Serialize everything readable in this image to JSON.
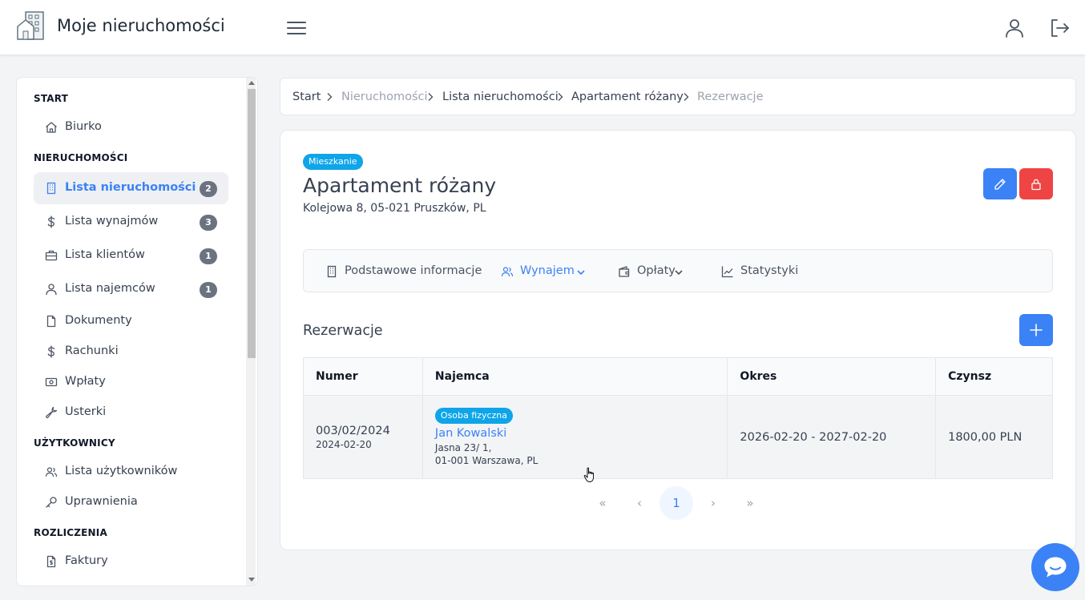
{
  "header": {
    "app_title": "Moje nieruchomości",
    "icons": [
      "building-logo-icon",
      "menu-icon",
      "user-icon",
      "logout-icon"
    ]
  },
  "sidebar": {
    "sections": [
      {
        "label": "START"
      },
      {
        "label": "NIERUCHOMOŚCI"
      },
      {
        "label": "UŻYTKOWNICY"
      },
      {
        "label": "ROZLICZENIA"
      }
    ],
    "items": [
      {
        "label": "Biurko",
        "icon": "home-icon"
      },
      {
        "label": "Lista nieruchomości",
        "icon": "building-icon",
        "badge": "2",
        "active": true
      },
      {
        "label": "Lista wynajmów",
        "icon": "dollar-icon",
        "badge": "3"
      },
      {
        "label": "Lista klientów",
        "icon": "briefcase-icon",
        "badge": "1"
      },
      {
        "label": "Lista najemców",
        "icon": "user-icon",
        "badge": "1"
      },
      {
        "label": "Dokumenty",
        "icon": "document-icon"
      },
      {
        "label": "Rachunki",
        "icon": "dollar-icon"
      },
      {
        "label": "Wpłaty",
        "icon": "cash-icon"
      },
      {
        "label": "Usterki",
        "icon": "wrench-icon"
      },
      {
        "label": "Lista użytkowników",
        "icon": "users-icon"
      },
      {
        "label": "Uprawnienia",
        "icon": "key-icon"
      },
      {
        "label": "Faktury",
        "icon": "invoice-icon"
      }
    ]
  },
  "breadcrumb": {
    "items": [
      "Start",
      "Nieruchomości",
      "Lista nieruchomości",
      "Apartament różany",
      "Rezerwacje"
    ]
  },
  "property": {
    "type_badge": "Mieszkanie",
    "title": "Apartament różany",
    "address": "Kolejowa 8, 05-021 Pruszków, PL"
  },
  "tabs": [
    {
      "label": "Podstawowe informacje",
      "icon": "building-icon"
    },
    {
      "label": "Wynajem",
      "icon": "users-icon",
      "active": true
    },
    {
      "label": "Opłaty",
      "icon": "wallet-icon"
    },
    {
      "label": "Statystyki",
      "icon": "chart-icon"
    }
  ],
  "reservations": {
    "title": "Rezerwacje",
    "columns": [
      "Numer",
      "Najemca",
      "Okres",
      "Czynsz"
    ],
    "rows": [
      {
        "number": "003/02/2024",
        "date": "2024-02-20",
        "tenant_type": "Osoba fizyczna",
        "tenant_name": "Jan Kowalski",
        "tenant_street": "Jasna 23/ 1,",
        "tenant_city": "01-001 Warszawa, PL",
        "period": "2026-02-20 - 2027-02-20",
        "rent": "1800,00 PLN"
      }
    ]
  },
  "pagination": {
    "first": "«",
    "prev": "‹",
    "current": "1",
    "next": "›",
    "last": "»"
  },
  "colors": {
    "primary": "#3b82f6",
    "danger": "#ef4444",
    "badge": "#0ea5e9",
    "sidebar_badge": "#6b7280"
  }
}
